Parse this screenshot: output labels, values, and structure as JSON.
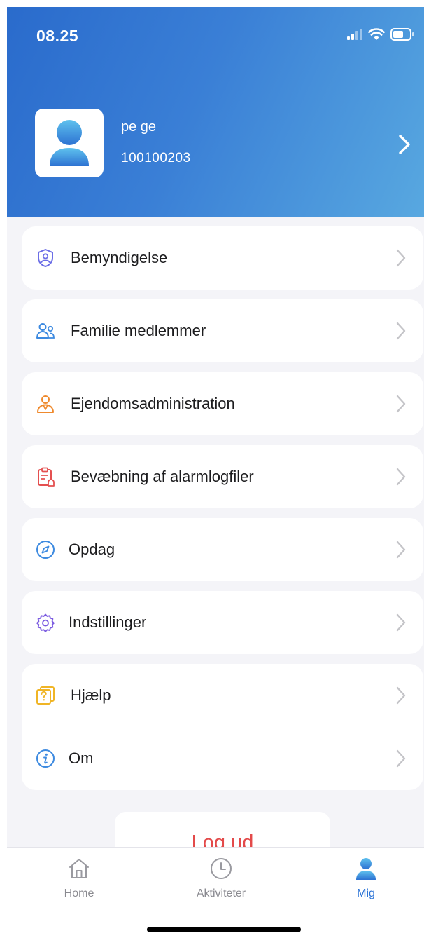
{
  "status_bar": {
    "time": "08.25",
    "icons": [
      "signal-icon",
      "wifi-icon",
      "battery-icon"
    ]
  },
  "profile": {
    "name": "pe ge",
    "id": "100100203",
    "avatar_icon": "user-avatar-icon"
  },
  "menu": {
    "items": [
      {
        "label": "Bemyndigelse",
        "icon": "shield-user-icon",
        "color": "#6c6ee6"
      },
      {
        "label": "Familie medlemmer",
        "icon": "family-members-icon",
        "color": "#3d8ae0"
      },
      {
        "label": "Ejendomsadministration",
        "icon": "property-admin-icon",
        "color": "#ef8a2e"
      },
      {
        "label": "Bevæbning af alarmlogfiler",
        "icon": "alarm-log-icon",
        "color": "#e45050"
      },
      {
        "label": "Opdag",
        "icon": "compass-icon",
        "color": "#3d8ae0"
      },
      {
        "label": "Indstillinger",
        "icon": "settings-gear-icon",
        "color": "#7a5ae0"
      },
      {
        "label": "Hjælp",
        "icon": "help-icon",
        "color": "#f0b526"
      },
      {
        "label": "Om",
        "icon": "info-icon",
        "color": "#3d8ae0"
      }
    ]
  },
  "logout": {
    "label": "Log ud"
  },
  "tabbar": {
    "tabs": [
      {
        "label": "Home",
        "icon": "home-icon",
        "active": false
      },
      {
        "label": "Aktiviteter",
        "icon": "clock-icon",
        "active": false
      },
      {
        "label": "Mig",
        "icon": "person-icon",
        "active": true
      }
    ]
  },
  "colors": {
    "header_start": "#2a6bcc",
    "header_end": "#58a8e0",
    "accent": "#2b73d6",
    "logout": "#e34a4a",
    "background": "#f4f4f8"
  }
}
